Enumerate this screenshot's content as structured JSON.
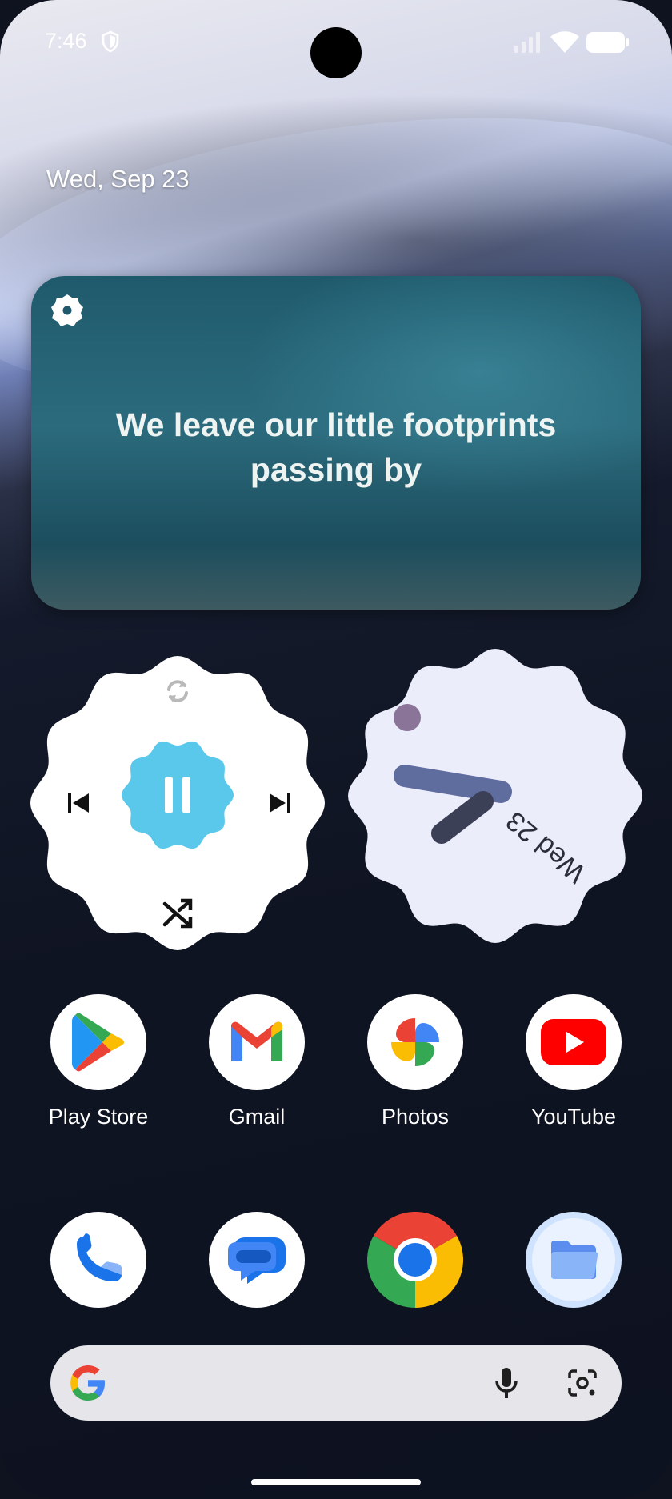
{
  "status_bar": {
    "time": "7:46",
    "icons": [
      "shield-icon",
      "cell-signal-icon",
      "wifi-icon",
      "battery-icon"
    ]
  },
  "home": {
    "date": "Wed, Sep 23"
  },
  "quote_widget": {
    "text": "We leave our little footprints passing by"
  },
  "media_widget": {
    "icons": [
      "repeat-icon",
      "previous-icon",
      "pause-icon",
      "next-icon",
      "shuffle-icon"
    ],
    "accent": "#5ac8ea"
  },
  "clock_widget": {
    "date_label": "Wed 23",
    "bg": "#ecedfb"
  },
  "apps": [
    {
      "label": "Play Store",
      "icon": "play-store-icon"
    },
    {
      "label": "Gmail",
      "icon": "gmail-icon"
    },
    {
      "label": "Photos",
      "icon": "photos-icon"
    },
    {
      "label": "YouTube",
      "icon": "youtube-icon"
    }
  ],
  "dock": [
    {
      "icon": "phone-icon"
    },
    {
      "icon": "messages-icon"
    },
    {
      "icon": "chrome-icon"
    },
    {
      "icon": "files-icon"
    }
  ],
  "search_bar": {
    "icons": [
      "google-logo-icon",
      "mic-icon",
      "lens-icon"
    ]
  }
}
